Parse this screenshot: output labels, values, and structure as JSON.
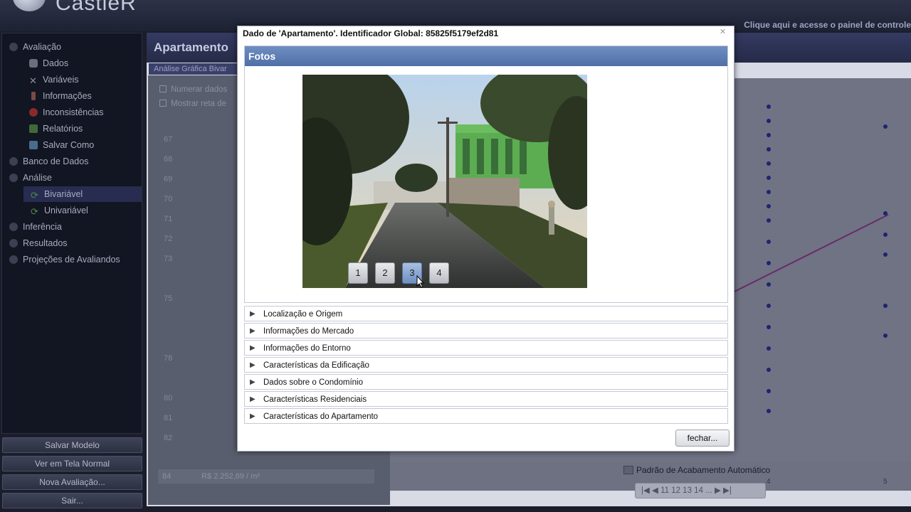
{
  "app": {
    "logo_text": "CastleR",
    "panel_link": "Clique aqui e acesse o painel de controle"
  },
  "sidebar": {
    "items": [
      {
        "label": "Avaliação",
        "icon": "circle-icon"
      },
      {
        "label": "Dados",
        "icon": "database-icon"
      },
      {
        "label": "Variáveis",
        "icon": "tools-icon"
      },
      {
        "label": "Informações",
        "icon": "info-icon"
      },
      {
        "label": "Inconsistências",
        "icon": "warning-icon"
      },
      {
        "label": "Relatórios",
        "icon": "report-icon"
      },
      {
        "label": "Salvar Como",
        "icon": "save-icon"
      },
      {
        "label": "Banco de Dados",
        "icon": "circle-icon"
      },
      {
        "label": "Análise",
        "icon": "circle-icon"
      },
      {
        "label": "Bivariável",
        "icon": "refresh-icon",
        "selected": true
      },
      {
        "label": "Univariável",
        "icon": "refresh-icon"
      },
      {
        "label": "Inferência",
        "icon": "circle-icon"
      },
      {
        "label": "Resultados",
        "icon": "circle-icon"
      },
      {
        "label": "Projeções de Avaliandos",
        "icon": "circle-icon"
      }
    ],
    "buttons": [
      "Salvar Modelo",
      "Ver em Tela Normal",
      "Nova Avaliação...",
      "Sair..."
    ]
  },
  "main": {
    "title": "Apartamento",
    "subtitle": "Análise Gráfica Bivar",
    "options": [
      "Numerar dados",
      "Mostrar reta de"
    ],
    "row_numbers": [
      "67",
      "68",
      "69",
      "70",
      "71",
      "72",
      "73",
      "75",
      "78",
      "80",
      "81",
      "82",
      "84"
    ],
    "last_row_value": "R$ 2.252,69 / m²",
    "x_ticks": [
      "4",
      "5"
    ],
    "chart_footer": "Padrão de Acabamento Automático",
    "pager": "|◀ ◀ 11 12 13 14 ... ▶ ▶|"
  },
  "modal": {
    "title": "Dado de 'Apartamento'. Identificador Global: 85825f5179ef2d81",
    "close_icon": "close-icon",
    "fotos_header": "Fotos",
    "photo_buttons": [
      "1",
      "2",
      "3",
      "4"
    ],
    "active_photo": "3",
    "sections": [
      "Localização e Origem",
      "Informações do Mercado",
      "Informações do Entorno",
      "Características da Edificação",
      "Dados sobre o Condomínio",
      "Características Residenciais",
      "Características do Apartamento"
    ],
    "close_button": "fechar..."
  }
}
